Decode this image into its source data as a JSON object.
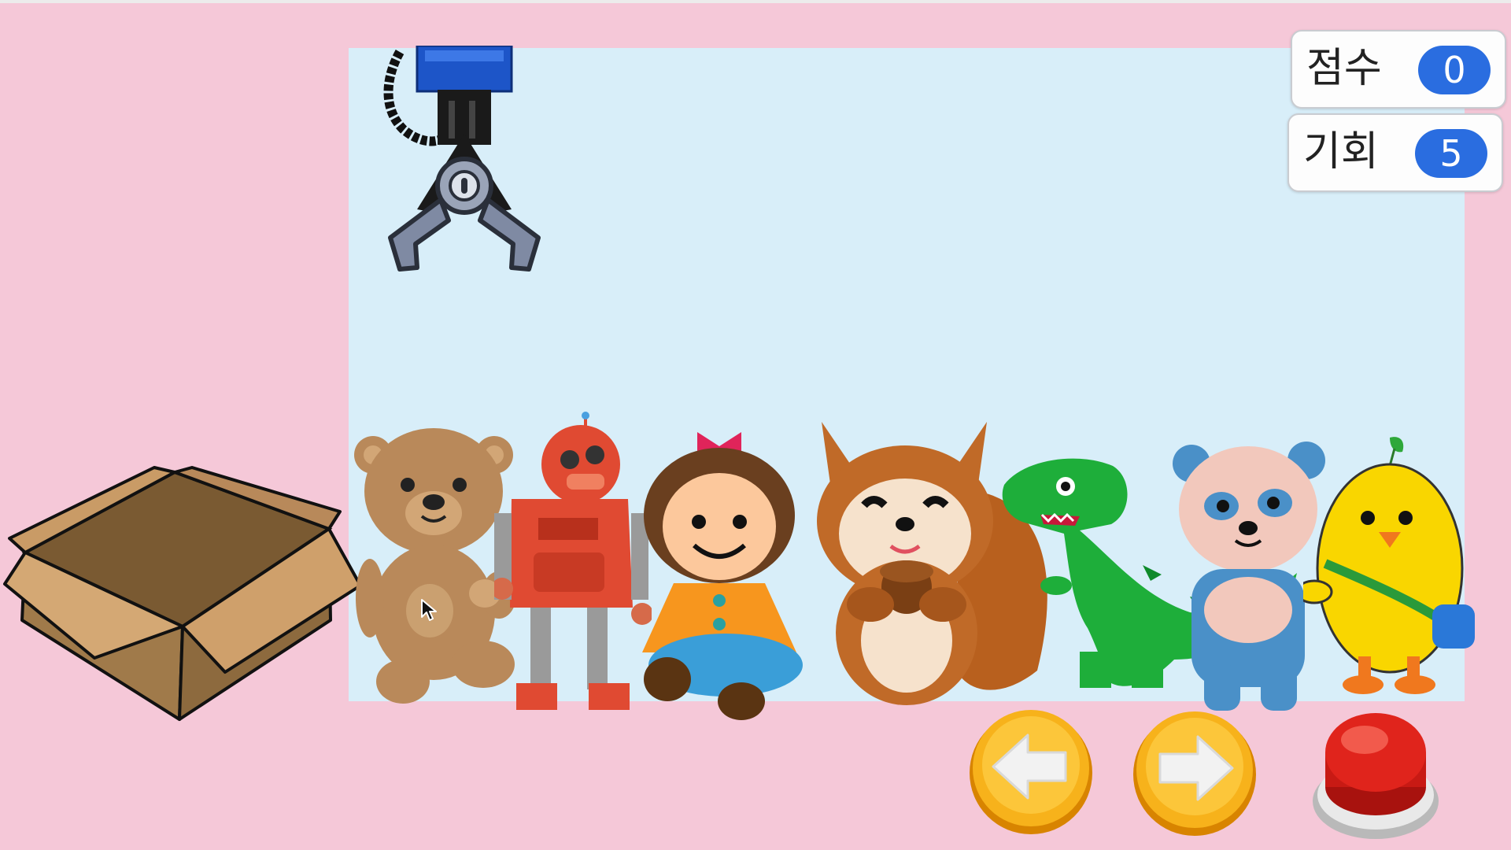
{
  "hud": {
    "score": {
      "label": "점수",
      "value": "0"
    },
    "chances": {
      "label": "기회",
      "value": "5"
    }
  },
  "toys": [
    {
      "icon": "teddy-bear-icon"
    },
    {
      "icon": "robot-icon"
    },
    {
      "icon": "doll-icon"
    },
    {
      "icon": "squirrel-icon"
    },
    {
      "icon": "dinosaur-icon"
    },
    {
      "icon": "panda-icon"
    },
    {
      "icon": "chick-icon"
    }
  ],
  "controls": [
    {
      "icon": "arrow-left-icon"
    },
    {
      "icon": "arrow-right-icon"
    },
    {
      "icon": "red-grab-button-icon"
    }
  ],
  "colors": {
    "background": "#f5c8d8",
    "stage": "#d8eef9",
    "badge": "#2a6de0",
    "control_orange": "#f7b21b",
    "grab_red": "#e0241c"
  }
}
